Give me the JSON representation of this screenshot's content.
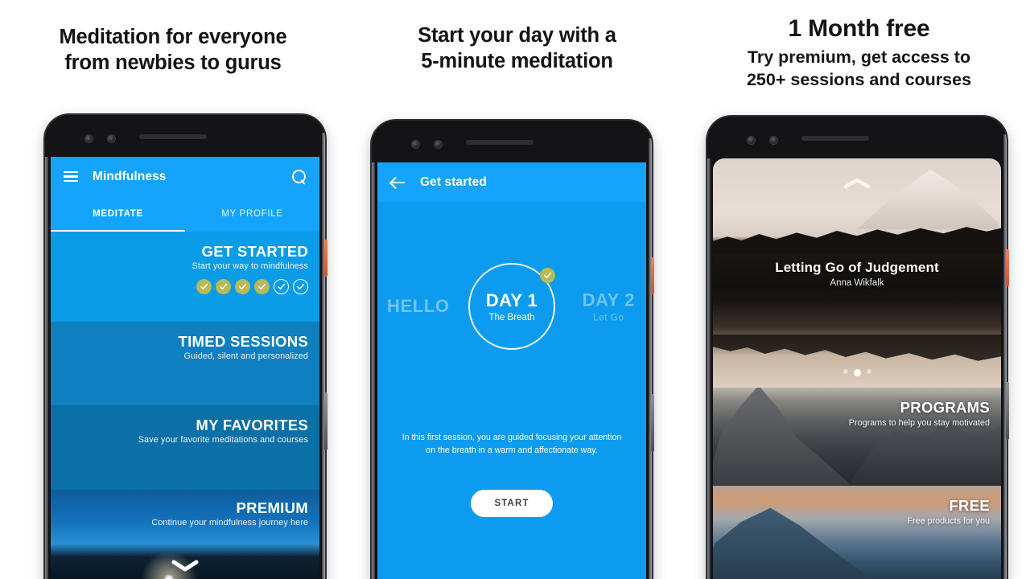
{
  "panels": [
    {
      "heading_lines": [
        "Meditation for everyone",
        "from newbies to gurus"
      ],
      "app": {
        "title": "Mindfulness",
        "menu_icon": "hamburger-icon",
        "search_icon": "search-icon",
        "tabs": [
          {
            "label": "MEDITATE",
            "active": true
          },
          {
            "label": "MY PROFILE",
            "active": false
          }
        ],
        "rows": [
          {
            "title": "GET STARTED",
            "subtitle": "Start your way to mindfulness",
            "progress": {
              "completed": 4,
              "total": 6,
              "done_color": "#b8b959"
            }
          },
          {
            "title": "TIMED SESSIONS",
            "subtitle": "Guided, silent and personalized"
          },
          {
            "title": "MY FAVORITES",
            "subtitle": "Save your favorite meditations and courses"
          },
          {
            "title": "PREMIUM",
            "subtitle": "Continue your mindfulness journey here",
            "scroll_icon": "chevron-down-icon"
          }
        ]
      }
    },
    {
      "heading_lines": [
        "Start your day with a",
        "5-minute meditation"
      ],
      "app": {
        "title": "Get started",
        "back_icon": "back-arrow-icon",
        "carousel": {
          "previous": {
            "title": "HELLO",
            "subtitle": ""
          },
          "current": {
            "title": "DAY 1",
            "subtitle": "The Breath",
            "completed": true,
            "badge_icon": "check-icon",
            "badge_color": "#b8b959"
          },
          "next": {
            "title": "DAY 2",
            "subtitle": "Let Go"
          }
        },
        "description": "In this first session, you are guided focusing your attention on the breath in a warm and affectionate way.",
        "start_label": "START"
      }
    },
    {
      "heading_title": "1 Month free",
      "heading_lines": [
        "Try premium, get access to",
        "250+ sessions and courses"
      ],
      "app": {
        "hero": {
          "title": "Letting Go of Judgement",
          "author": "Anna Wikfalk",
          "collapse_icon": "chevron-up-icon",
          "dots": {
            "count": 3,
            "active_index": 1
          }
        },
        "tiles": [
          {
            "title": "PROGRAMS",
            "subtitle": "Programs to help you stay motivated"
          },
          {
            "title": "FREE",
            "subtitle": "Free products for you"
          }
        ]
      }
    }
  ],
  "theme": {
    "appbar_blue": "#15A4FB",
    "row_blue_1": "#0B9CE8",
    "row_blue_2": "#0E7FC0",
    "row_blue_3": "#0B6FA8",
    "check_olive": "#b8b959",
    "page_bg": "#ffffff"
  }
}
